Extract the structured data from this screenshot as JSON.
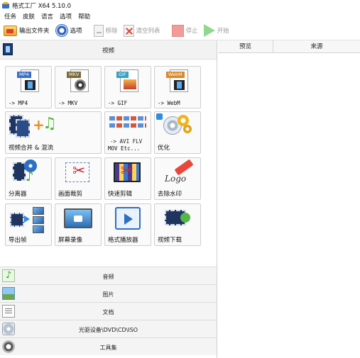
{
  "window": {
    "title": "格式工厂 X64 5.10.0"
  },
  "menu": [
    "任务",
    "皮肤",
    "语言",
    "选项",
    "帮助"
  ],
  "toolbar": {
    "output_folder": "输出文件夹",
    "options": "选项",
    "remove": "移除",
    "clear_list": "清空列表",
    "stop": "停止",
    "start": "开始"
  },
  "video_section": {
    "title": "视频",
    "tiles": [
      {
        "label": "-> MP4",
        "badge": "MP4",
        "badge_color": "#3a6fc4"
      },
      {
        "label": "-> MKV",
        "badge": "MKV",
        "badge_color": "#7b6a3a"
      },
      {
        "label": "-> GIF",
        "badge": "GIF",
        "badge_color": "#3aa0c4"
      },
      {
        "label": "-> WebM",
        "badge": "WebM",
        "badge_color": "#d9892b"
      },
      {
        "label": "视频合并 & 混流"
      },
      {
        "label_line1": "-> AVI FLV",
        "label_line2": "MOV Etc..."
      },
      {
        "label": "优化"
      },
      {
        "label": "分离器"
      },
      {
        "label": "画面裁剪"
      },
      {
        "label": "快速剪辑"
      },
      {
        "label": "去除水印",
        "logo_text": "Logo"
      },
      {
        "label": "导出帧"
      },
      {
        "label": "屏幕录像"
      },
      {
        "label": "格式播放器"
      },
      {
        "label": "视频下载"
      }
    ]
  },
  "categories": [
    "音频",
    "图片",
    "文档",
    "光驱设备\\DVD\\CD\\ISO",
    "工具集"
  ],
  "task_list": {
    "columns": [
      "预览",
      "来源"
    ]
  },
  "icons": {
    "folder": "folder-icon",
    "options": "options-icon",
    "remove": "remove-icon",
    "clear": "clear-icon",
    "stop": "stop-icon",
    "start": "play-icon"
  }
}
